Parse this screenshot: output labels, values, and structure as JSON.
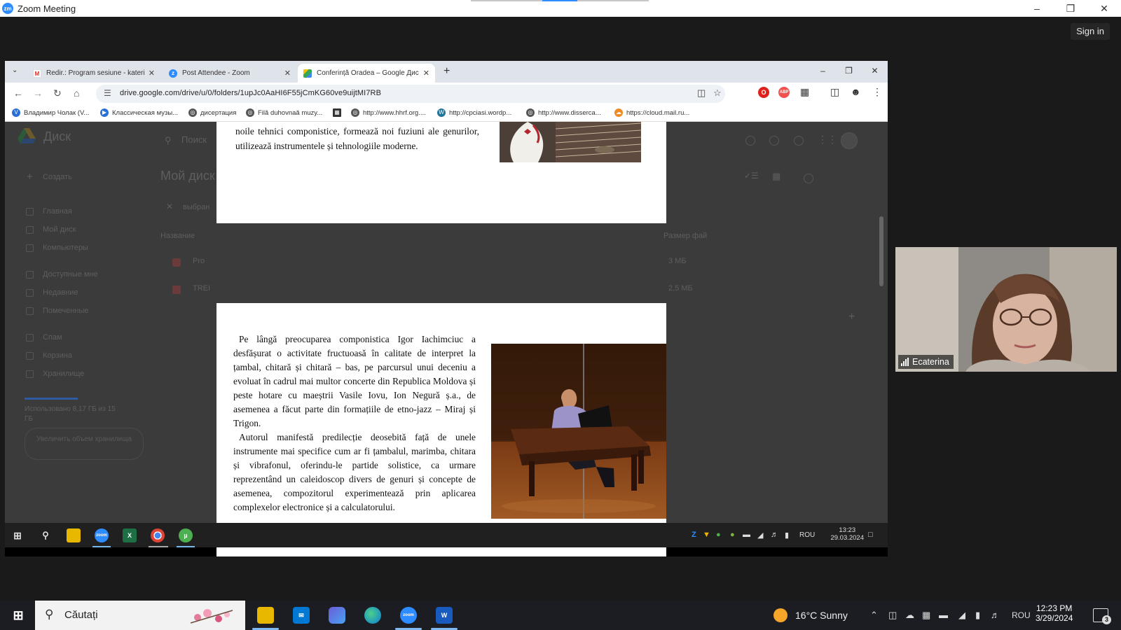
{
  "zoom": {
    "window_title": "Zoom Meeting",
    "sign_in": "Sign in",
    "participant_name": "Ecaterina"
  },
  "chrome": {
    "tabs": [
      {
        "title": "Redir.: Program sesiune - katerin",
        "icon": "gmail-icon"
      },
      {
        "title": "Post Attendee - Zoom",
        "icon": "zoom-icon"
      },
      {
        "title": "Conferință Oradea – Google Диск",
        "icon": "google-drive-icon"
      }
    ],
    "url": "drive.google.com/drive/u/0/folders/1upJc0AaHI6F55jCmKG60ve9uijtMI7RB",
    "bookmarks": [
      "Владимир Чолак (V...",
      "Классическая музы...",
      "дисертация",
      "Filă duhovnaă muzy...",
      "",
      "http://www.hhrf.org....",
      "http://cpciasi.wordp...",
      "http://www.disserca...",
      "https://cloud.mail.ru..."
    ]
  },
  "drive": {
    "app_name": "Диск",
    "search_placeholder": "Поиск",
    "page_title": "Мой диск",
    "new_button": "Создать",
    "selected_label": "выбран",
    "col_name": "Название",
    "col_size": "Размер фай",
    "rows": [
      {
        "name": "Pro",
        "size": "3 МБ"
      },
      {
        "name": "TREI",
        "size": "2,5 МБ"
      }
    ],
    "nav": [
      "Главная",
      "Мой диск",
      "Компьютеры",
      "Доступные мне",
      "Недавние",
      "Помеченные",
      "Спам",
      "Корзина",
      "Хранилище"
    ],
    "storage_text": "Использовано 8,17 ГБ из 15 ГБ",
    "upgrade_button": "Увеличить объем хранилища"
  },
  "document": {
    "page1_text": "noile tehnici componistice, formează noi fuziuni ale genurilor, utilizează instrumentele și tehnologiile moderne.",
    "page2_para1": "Pe lângă preocuparea componistica Igor Iachimciuc a desfășurat o activitate fructuoasă în calitate de interpret la țambal, chitară și chitară – bas, pe parcursul unui deceniu a evoluat în cadrul mai multor concerte din Republica Moldova și peste hotare cu maeștrii Vasile Iovu, Ion Negură ș.a., de asemenea a făcut parte din formațiile de etno-jazz – Miraj și Trigon.",
    "page2_para2": "Autorul manifestă predilecție deosebită față de unele instrumente mai specifice cum ar fi țambalul, marimba, chitara și vibrafonul, oferindu-le partide solistice, ca urmare reprezentând un caleidoscop divers de genuri și concepte de asemenea, compozitorul experimentează prin aplicarea complexelor electronice și a calculatorului."
  },
  "remote_taskbar": {
    "language": "ROU",
    "time": "13:23",
    "date": "29.03.2024"
  },
  "os_taskbar": {
    "search_label": "Căutați",
    "weather": "16°C  Sunny",
    "language": "ROU",
    "time": "12:23 PM",
    "date": "3/29/2024",
    "notification_count": "3"
  }
}
